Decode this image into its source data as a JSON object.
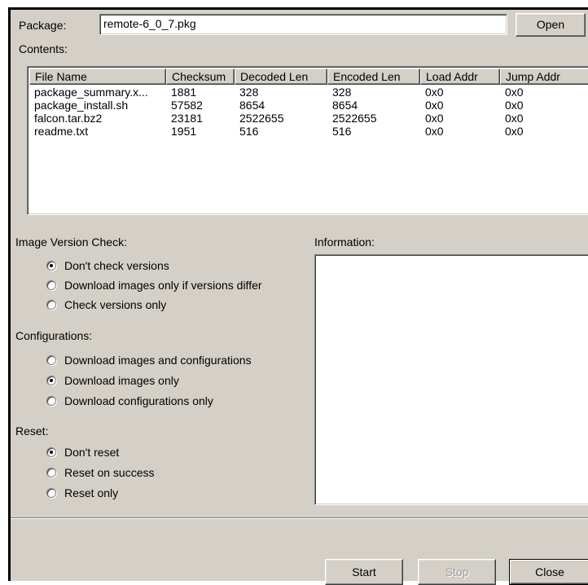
{
  "package": {
    "label": "Package:",
    "value": "remote-6_0_7.pkg",
    "open_label": "Open"
  },
  "contents": {
    "label": "Contents:",
    "columns": [
      "File Name",
      "Checksum",
      "Decoded Len",
      "Encoded Len",
      "Load Addr",
      "Jump Addr"
    ],
    "rows": [
      [
        "package_summary.x...",
        "1881",
        "328",
        "328",
        "0x0",
        "0x0"
      ],
      [
        "package_install.sh",
        "57582",
        "8654",
        "8654",
        "0x0",
        "0x0"
      ],
      [
        "falcon.tar.bz2",
        "23181",
        "2522655",
        "2522655",
        "0x0",
        "0x0"
      ],
      [
        "readme.txt",
        "1951",
        "516",
        "516",
        "0x0",
        "0x0"
      ]
    ]
  },
  "image_version": {
    "label": "Image Version Check:",
    "options": [
      "Don't check versions",
      "Download images only if versions differ",
      "Check versions only"
    ],
    "selected": 0
  },
  "configurations": {
    "label": "Configurations:",
    "options": [
      "Download images and configurations",
      "Download images only",
      "Download configurations only"
    ],
    "selected": 1
  },
  "reset": {
    "label": "Reset:",
    "options": [
      "Don't reset",
      "Reset on success",
      "Reset only"
    ],
    "selected": 0
  },
  "information": {
    "label": "Information:",
    "text": ""
  },
  "buttons": {
    "start": "Start",
    "stop": "Stop",
    "close": "Close"
  }
}
